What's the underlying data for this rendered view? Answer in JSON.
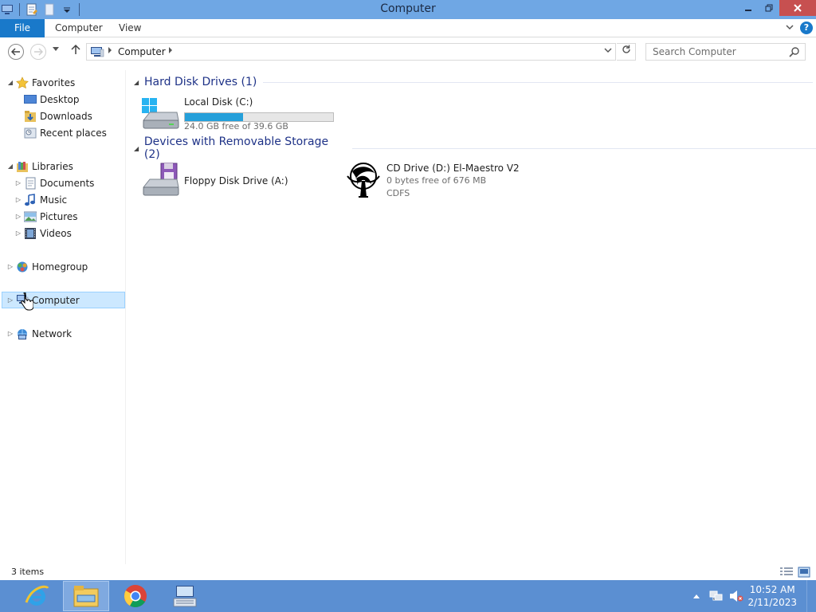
{
  "window": {
    "title": "Computer"
  },
  "ribbon": {
    "tabs": [
      "File",
      "Computer",
      "View"
    ]
  },
  "address": {
    "crumb": "Computer"
  },
  "search": {
    "placeholder": "Search Computer"
  },
  "nav": {
    "favorites": "Favorites",
    "desktop": "Desktop",
    "downloads": "Downloads",
    "recent_places": "Recent places",
    "libraries": "Libraries",
    "documents": "Documents",
    "music": "Music",
    "pictures": "Pictures",
    "videos": "Videos",
    "homegroup": "Homegroup",
    "computer": "Computer",
    "network": "Network"
  },
  "groups": {
    "hdd": {
      "title": "Hard Disk Drives (1)",
      "drives": [
        {
          "name": "Local Disk (C:)",
          "free_text": "24.0 GB free of 39.6 GB",
          "used_fraction": 0.39
        }
      ]
    },
    "removable": {
      "title": "Devices with Removable Storage (2)",
      "drives": [
        {
          "name": "Floppy Disk Drive (A:)"
        },
        {
          "name": "CD Drive (D:) El-Maestro V2",
          "free_text": "0 bytes free of 676 MB",
          "filesystem": "CDFS"
        }
      ]
    }
  },
  "status": {
    "items": "3 items"
  },
  "taskbar": {
    "time": "10:52 AM",
    "date": "2/11/2023"
  },
  "colors": {
    "titlebar": "#6fa7e4",
    "accent": "#1979ca",
    "taskbar": "#5b8fd2",
    "progress": "#26a0da",
    "close": "#c75050"
  }
}
